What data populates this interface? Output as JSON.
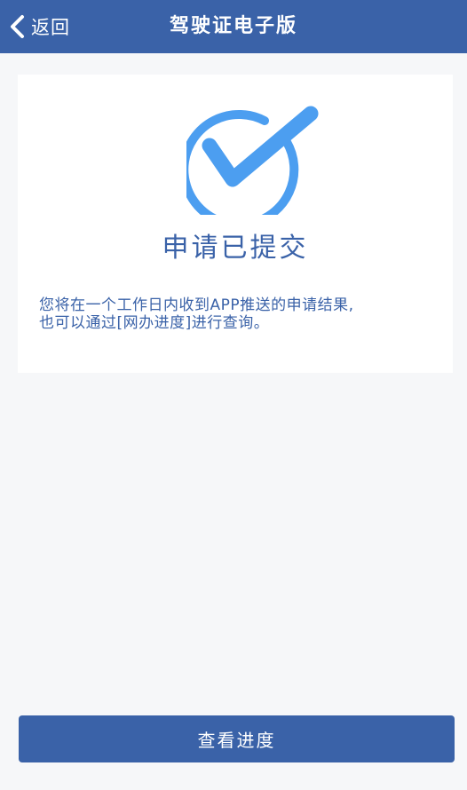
{
  "navbar": {
    "back_label": "返回",
    "title": "驾驶证电子版",
    "back_icon": "chevron-left-icon"
  },
  "status": {
    "icon": "check-circle-icon",
    "title": "申请已提交",
    "desc_line1": "您将在一个工作日内收到APP推送的申请结果,",
    "desc_line2": "也可以通过[网办进度]进行查询。"
  },
  "action": {
    "progress_label": "查看进度"
  },
  "colors": {
    "brand": "#3a62a8",
    "check": "#4c9ef0",
    "background": "#f6f7f9"
  }
}
